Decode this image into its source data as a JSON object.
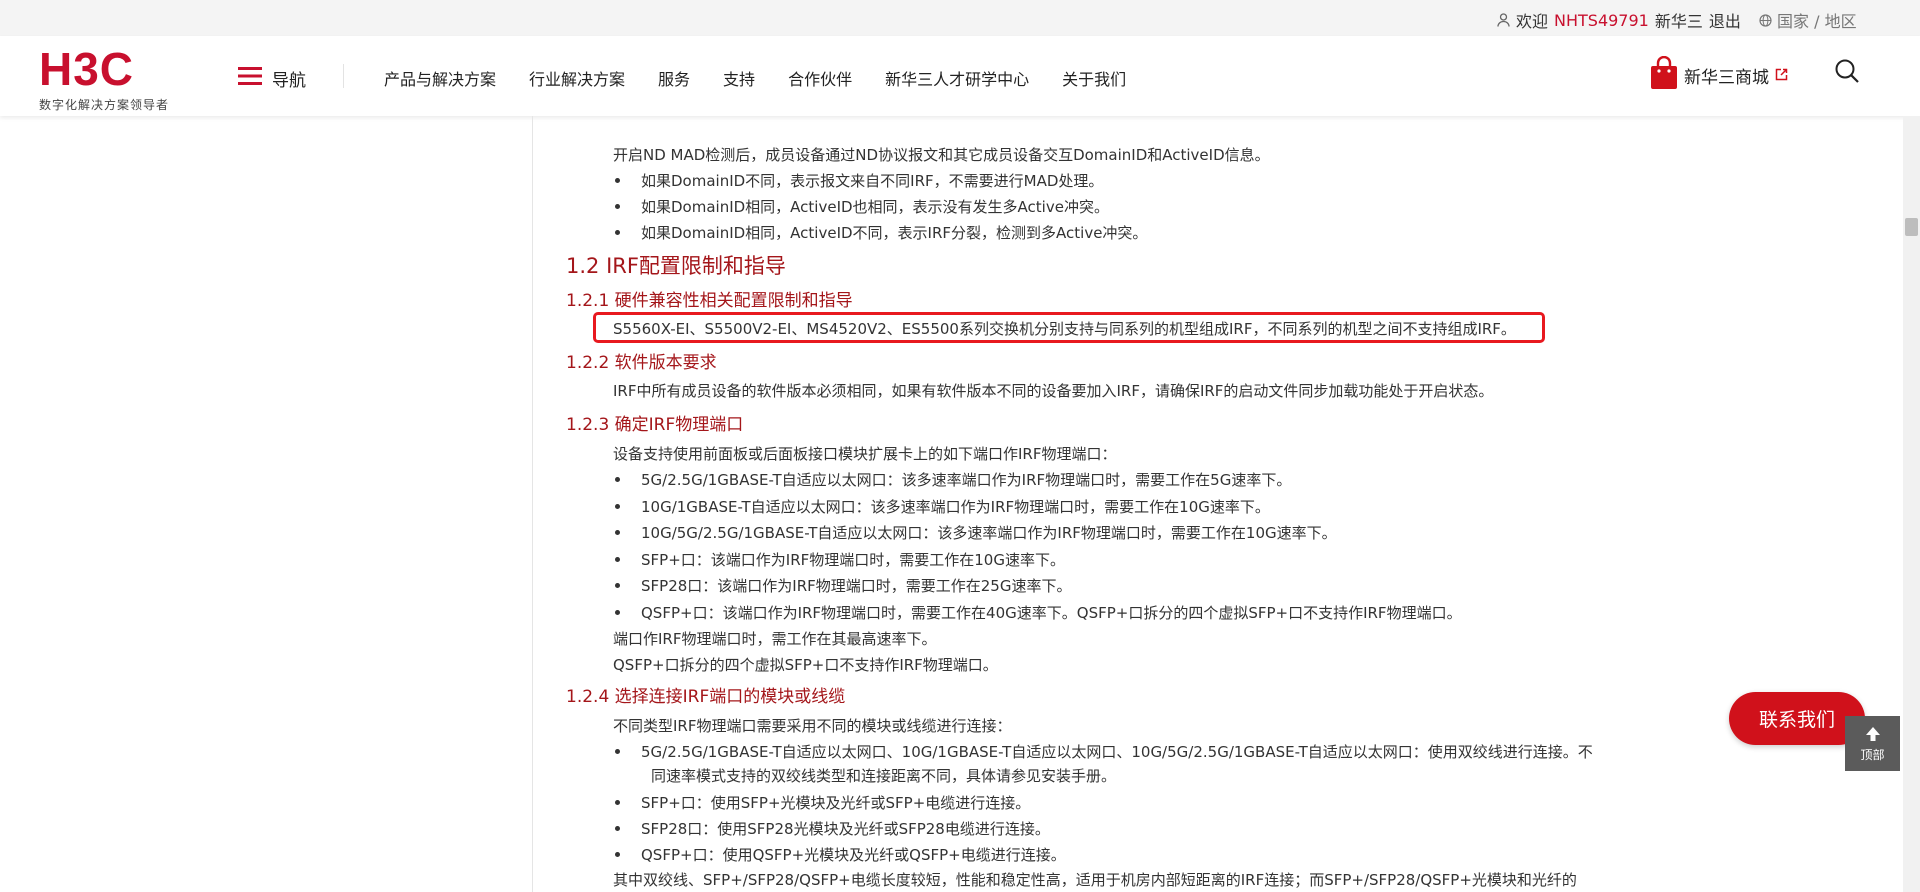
{
  "topbar": {
    "welcome": "欢迎",
    "username": "NHTS49791",
    "company": "新华三",
    "logout": "退出",
    "region": "国家 / 地区",
    "icons": {
      "user": "user-icon",
      "globe": "globe-icon"
    }
  },
  "header": {
    "logo_text": "H3C",
    "slogan": "数字化解决方案领导者",
    "nav_toggle": "导航",
    "nav_items": [
      "产品与解决方案",
      "行业解决方案",
      "服务",
      "支持",
      "合作伙伴",
      "新华三人才研学中心",
      "关于我们"
    ],
    "mall": "新华三商城",
    "icons": {
      "menu": "hamburger-icon",
      "bag": "shopping-bag-icon",
      "external": "external-link-icon",
      "search": "search-icon"
    }
  },
  "colors": {
    "brand": "#c8102e",
    "heading": "#a4161a",
    "highlight_box": "#e8191f",
    "contact_button": "#d0111b"
  },
  "doc": {
    "p_nd_mad": "开启ND MAD检测后，成员设备通过ND协议报文和其它成员设备交互DomainID和ActiveID信息。",
    "mad_bullets": [
      "如果DomainID不同，表示报文来自不同IRF，不需要进行MAD处理。",
      "如果DomainID相同，ActiveID也相同，表示没有发生多Active冲突。",
      "如果DomainID相同，ActiveID不同，表示IRF分裂，检测到多Active冲突。"
    ],
    "h_1_2": "1.2  IRF配置限制和指导",
    "h_1_2_1": "1.2.1  硬件兼容性相关配置限制和指导",
    "p_hw": "S5560X-EI、S5500V2-EI、MS4520V2、ES5500系列交换机分别支持与同系列的机型组成IRF，不同系列的机型之间不支持组成IRF。",
    "h_1_2_2": "1.2.2  软件版本要求",
    "p_sw": "IRF中所有成员设备的软件版本必须相同，如果有软件版本不同的设备要加入IRF，请确保IRF的启动文件同步加载功能处于开启状态。",
    "h_1_2_3": "1.2.3  确定IRF物理端口",
    "p_port_intro": "设备支持使用前面板或后面板接口模块扩展卡上的如下端口作IRF物理端口：",
    "port_bullets": [
      "5G/2.5G/1GBASE-T自适应以太网口：该多速率端口作为IRF物理端口时，需要工作在5G速率下。",
      "10G/1GBASE-T自适应以太网口：该多速率端口作为IRF物理端口时，需要工作在10G速率下。",
      "10G/5G/2.5G/1GBASE-T自适应以太网口：该多速率端口作为IRF物理端口时，需要工作在10G速率下。",
      "SFP+口：该端口作为IRF物理端口时，需要工作在10G速率下。",
      "SFP28口：该端口作为IRF物理端口时，需要工作在25G速率下。",
      "QSFP+口：该端口作为IRF物理端口时，需要工作在40G速率下。QSFP+口拆分的四个虚拟SFP+口不支持作IRF物理端口。"
    ],
    "p_port_note1": "端口作IRF物理端口时，需工作在其最高速率下。",
    "p_port_note2": "QSFP+口拆分的四个虚拟SFP+口不支持作IRF物理端口。",
    "h_1_2_4": "1.2.4  选择连接IRF端口的模块或线缆",
    "p_cable_intro": "不同类型IRF物理端口需要采用不同的模块或线缆进行连接：",
    "cable_b1_l1": "5G/2.5G/1GBASE-T自适应以太网口、10G/1GBASE-T自适应以太网口、10G/5G/2.5G/1GBASE-T自适应以太网口：使用双绞线进行连接。不",
    "cable_b1_l2": "同速率模式支持的双绞线类型和连接距离不同，具体请参见安装手册。",
    "cable_bullets": [
      "SFP+口：使用SFP+光模块及光纤或SFP+电缆进行连接。",
      "SFP28口：使用SFP28光模块及光纤或SFP28电缆进行连接。",
      "QSFP+口：使用QSFP+光模块及光纤或QSFP+电缆进行连接。"
    ],
    "p_last": "其中双绞线、SFP+/SFP28/QSFP+电缆长度较短，性能和稳定性高，适用于机房内部短距离的IRF连接；而SFP+/SFP28/QSFP+光模块和光纤的"
  },
  "float": {
    "contact": "联系我们",
    "top": "顶部",
    "icons": {
      "up": "arrow-up-icon"
    }
  }
}
